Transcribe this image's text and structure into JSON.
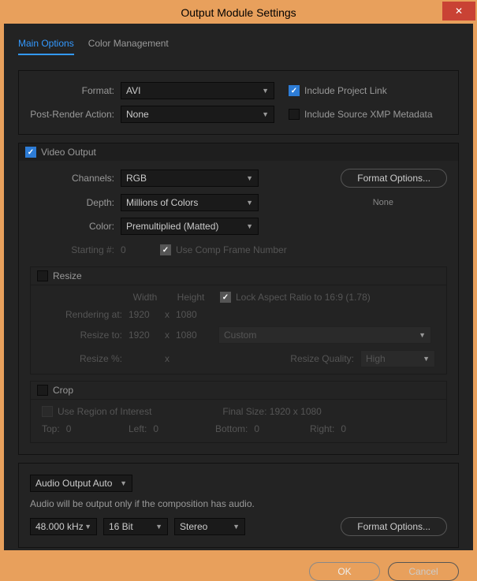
{
  "window": {
    "title": "Output Module Settings"
  },
  "tabs": {
    "main": "Main Options",
    "color": "Color Management"
  },
  "top": {
    "format_label": "Format:",
    "format_value": "AVI",
    "include_link": "Include Project Link",
    "post_render_label": "Post-Render Action:",
    "post_render_value": "None",
    "include_xmp": "Include Source XMP Metadata"
  },
  "video": {
    "header": "Video Output",
    "channels_label": "Channels:",
    "channels_value": "RGB",
    "depth_label": "Depth:",
    "depth_value": "Millions of Colors",
    "color_label": "Color:",
    "color_value": "Premultiplied (Matted)",
    "starting_label": "Starting #:",
    "starting_value": "0",
    "use_comp": "Use Comp Frame Number",
    "format_options": "Format Options...",
    "none": "None"
  },
  "resize": {
    "header": "Resize",
    "width": "Width",
    "height": "Height",
    "lock_aspect": "Lock Aspect Ratio to 16:9 (1.78)",
    "rendering_at": "Rendering at:",
    "rendering_w": "1920",
    "rendering_h": "1080",
    "resize_to": "Resize to:",
    "resize_w": "1920",
    "resize_h": "1080",
    "custom": "Custom",
    "resize_pct": "Resize %:",
    "quality_label": "Resize Quality:",
    "quality_value": "High"
  },
  "crop": {
    "header": "Crop",
    "use_roi": "Use Region of Interest",
    "final_size_label": "Final Size:",
    "final_size_value": "1920 x 1080",
    "top": "Top:",
    "top_v": "0",
    "left": "Left:",
    "left_v": "0",
    "bottom": "Bottom:",
    "bottom_v": "0",
    "right": "Right:",
    "right_v": "0"
  },
  "audio": {
    "mode": "Audio Output Auto",
    "desc": "Audio will be output only if the composition has audio.",
    "rate": "48.000 kHz",
    "depth": "16 Bit",
    "channels": "Stereo",
    "format_options": "Format Options..."
  },
  "buttons": {
    "ok": "OK",
    "cancel": "Cancel"
  }
}
